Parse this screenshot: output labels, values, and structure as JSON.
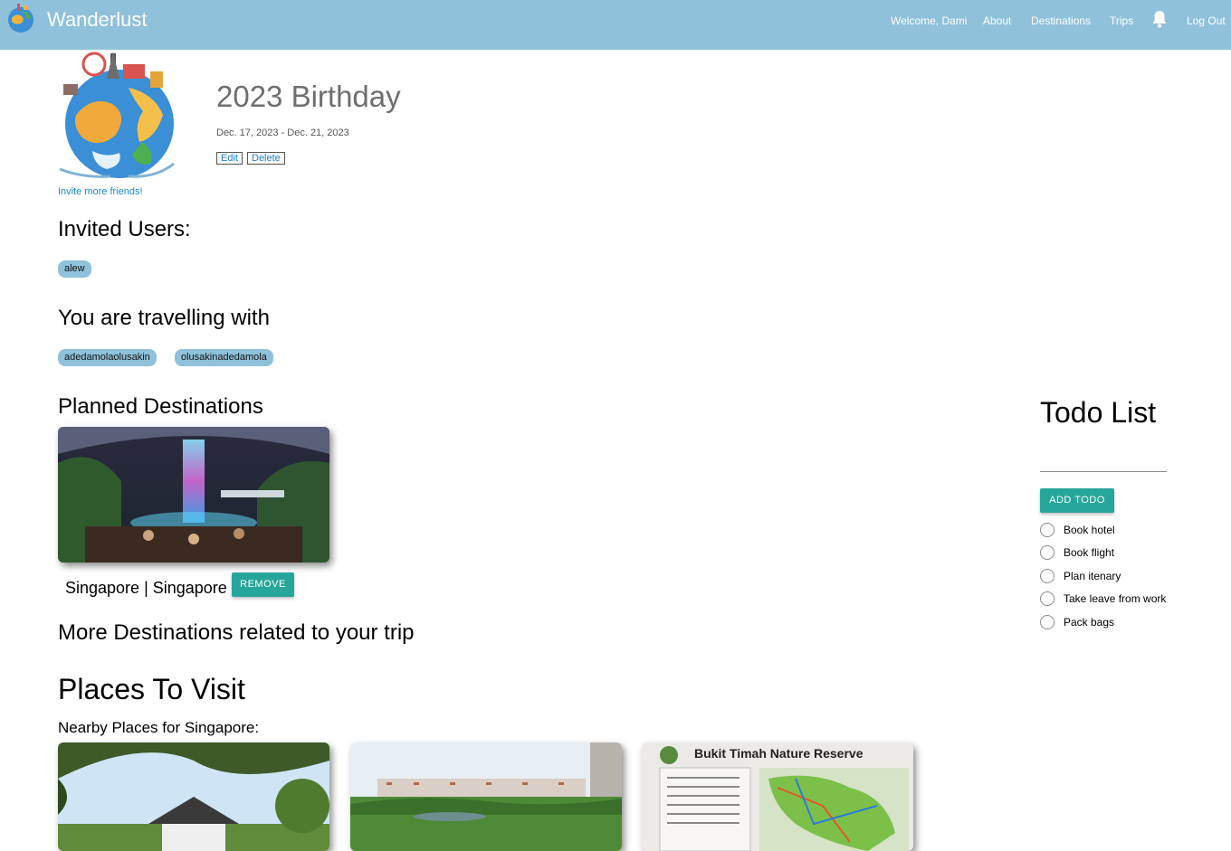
{
  "nav": {
    "brand": "Wanderlust",
    "welcome": "Welcome, Dami",
    "about": "About",
    "destinations": "Destinations",
    "trips": "Trips",
    "logout": "Log Out",
    "bell_icon": "bell-icon",
    "bar_color": "#8fc1da"
  },
  "trip": {
    "title": "2023 Birthday",
    "dates": "Dec. 17, 2023 - Dec. 21, 2023",
    "edit_label": "Edit",
    "delete_label": "Delete",
    "invite_label": "Invite more friends!"
  },
  "invited": {
    "heading": "Invited Users:",
    "users": [
      "alew"
    ]
  },
  "travelling": {
    "heading": "You are travelling with",
    "users": [
      "adedamolaolusakin",
      "olusakinadedamola"
    ]
  },
  "planned": {
    "heading": "Planned Destinations",
    "destination_label": "Singapore | Singapore",
    "remove_label": "REMOVE"
  },
  "more": {
    "heading": "More Destinations related to your trip"
  },
  "places": {
    "heading": "Places To Visit",
    "nearby_heading": "Nearby Places for Singapore:",
    "cards": [
      {
        "sign_text": ""
      },
      {
        "sign_text": ""
      },
      {
        "sign_text": "Bukit Timah Nature Reserve"
      }
    ]
  },
  "todo": {
    "title": "Todo List",
    "input_value": "",
    "add_label": "ADD TODO",
    "items": [
      "Book hotel",
      "Book flight",
      "Plan itenary",
      "Take leave from work",
      "Pack bags"
    ],
    "accent_color": "#26a69a"
  }
}
